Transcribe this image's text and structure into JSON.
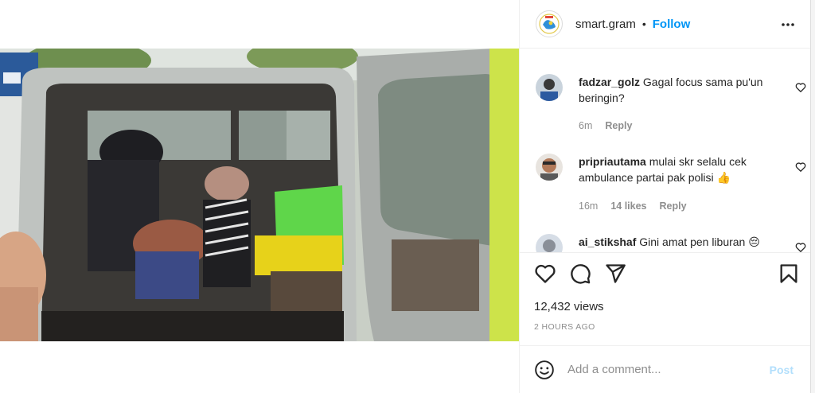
{
  "header": {
    "username": "smart.gram",
    "separator": "•",
    "follow_label": "Follow",
    "more_icon": "more-horizontal-icon"
  },
  "comments": [
    {
      "username": "fadzar_golz",
      "text": "Gagal focus sama pu'un beringin?",
      "time": "6m",
      "likes": "",
      "reply_label": "Reply"
    },
    {
      "username": "pripriautama",
      "text": "mulai skr selalu cek ambulance partai pak polisi 👍",
      "time": "16m",
      "likes": "14 likes",
      "reply_label": "Reply"
    },
    {
      "username": "ai_stikshaf",
      "text": "Gini amat pen liburan 😔",
      "time": "",
      "likes": "",
      "reply_label": ""
    }
  ],
  "actions": {
    "views": "12,432 views",
    "posted": "2 HOURS AGO"
  },
  "add_comment": {
    "placeholder": "Add a comment...",
    "post_label": "Post"
  },
  "colors": {
    "accent": "#0095f6",
    "post_disabled": "#b2dffc",
    "muted": "#8e8e8e",
    "text": "#262626"
  }
}
